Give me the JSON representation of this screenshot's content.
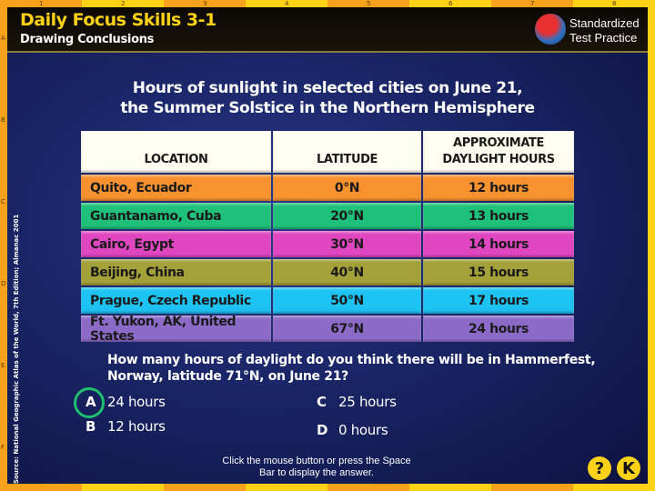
{
  "ruler": {
    "numbers": [
      "1",
      "2",
      "3",
      "4",
      "5",
      "6",
      "7",
      "8"
    ],
    "letters": [
      "A",
      "B",
      "C",
      "D",
      "E",
      "F"
    ]
  },
  "header": {
    "title": "Daily Focus Skills 3-1",
    "subtitle": "Drawing Conclusions",
    "badge_line1": "Standardized",
    "badge_line2": "Test Practice"
  },
  "source": "Source: National Geographic Atlas of the World, 7th Edition; Almanac 2001",
  "table": {
    "title_line1": "Hours of sunlight in selected cities on June 21,",
    "title_line2": "the Summer Solstice in the Northern Hemisphere",
    "headers": [
      "LOCATION",
      "LATITUDE",
      "APPROXIMATE DAYLIGHT HOURS"
    ],
    "rows": [
      {
        "location": "Quito, Ecuador",
        "latitude": "0°N",
        "hours": "12 hours",
        "color": "#f7922e"
      },
      {
        "location": "Guantanamo, Cuba",
        "latitude": "20°N",
        "hours": "13 hours",
        "color": "#1fc07a"
      },
      {
        "location": "Cairo, Egypt",
        "latitude": "30°N",
        "hours": "14 hours",
        "color": "#e046c0"
      },
      {
        "location": "Beijing, China",
        "latitude": "40°N",
        "hours": "15 hours",
        "color": "#a4a03a"
      },
      {
        "location": "Prague, Czech Republic",
        "latitude": "50°N",
        "hours": "17 hours",
        "color": "#1dc3f2"
      },
      {
        "location": "Ft. Yukon, AK, United States",
        "latitude": "67°N",
        "hours": "24 hours",
        "color": "#8c6ac8"
      }
    ]
  },
  "question": "How many hours of daylight do you think there will be in Hammerfest, Norway, latitude 71°N, on June 21?",
  "options": [
    {
      "letter": "A",
      "text": "24 hours",
      "selected": true
    },
    {
      "letter": "B",
      "text": "12 hours"
    },
    {
      "letter": "C",
      "text": "25 hours"
    },
    {
      "letter": "D",
      "text": "0 hours"
    }
  ],
  "prompt": "Click the mouse button or press the Space Bar to display the answer.",
  "buttons": {
    "help": "?",
    "back": "K"
  }
}
